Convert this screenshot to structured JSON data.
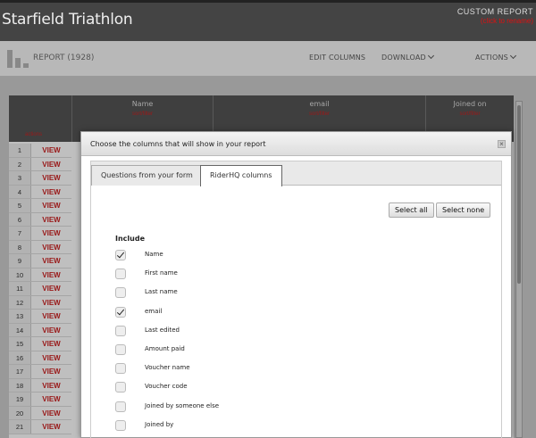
{
  "header": {
    "title": "Starfield Triathlon",
    "custom_report": "CUSTOM REPORT",
    "custom_report_sub": "(click to rename)"
  },
  "toolbar": {
    "report_label": "REPORT (1928)",
    "edit_columns": "EDIT COLUMNS",
    "download": "DOWNLOAD",
    "actions": "ACTIONS"
  },
  "table": {
    "corner_sub": "actions",
    "columns": [
      {
        "name": "Name",
        "sub": "sort/filter"
      },
      {
        "name": "email",
        "sub": "sort/filter"
      },
      {
        "name": "Joined on",
        "sub": "sort/filter"
      }
    ],
    "view_label": "VIEW",
    "rows": [
      "1",
      "2",
      "3",
      "4",
      "5",
      "6",
      "7",
      "8",
      "9",
      "10",
      "11",
      "12",
      "13",
      "14",
      "15",
      "16",
      "17",
      "18",
      "19",
      "20",
      "21"
    ]
  },
  "modal": {
    "title": "Choose the columns that will show in your report",
    "close": "×",
    "tabs": [
      {
        "label": "Questions from your form",
        "active": false
      },
      {
        "label": "RiderHQ columns",
        "active": true
      }
    ],
    "select_all": "Select all",
    "select_none": "Select none",
    "include_label": "Include",
    "options": [
      {
        "label": "Name",
        "checked": true
      },
      {
        "label": "First name",
        "checked": false
      },
      {
        "label": "Last name",
        "checked": false
      },
      {
        "label": "email",
        "checked": true
      },
      {
        "label": "Last edited",
        "checked": false
      },
      {
        "label": "Amount paid",
        "checked": false
      },
      {
        "label": "Voucher name",
        "checked": false
      },
      {
        "label": "Voucher code",
        "checked": false
      },
      {
        "label": "Joined by someone else",
        "checked": false
      },
      {
        "label": "Joined by",
        "checked": false
      }
    ]
  }
}
